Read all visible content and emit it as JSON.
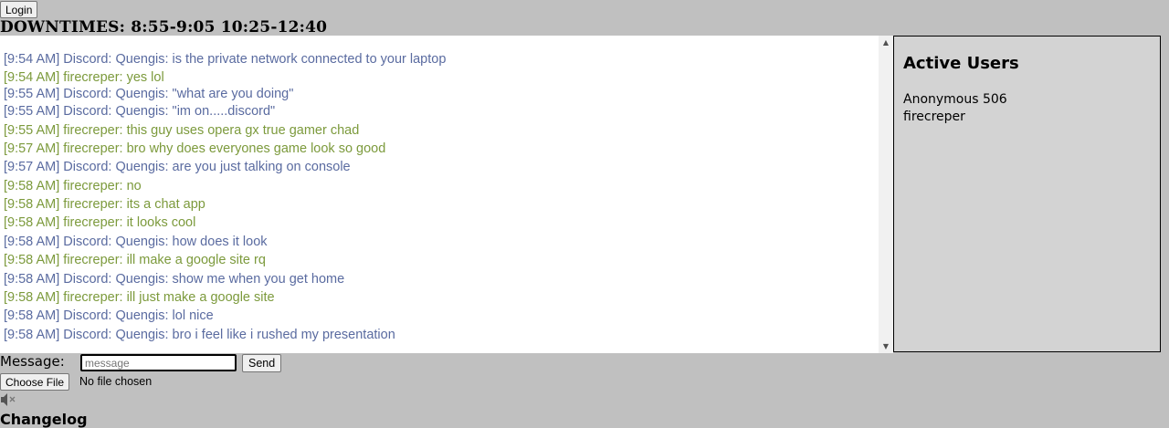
{
  "header": {
    "login_label": "Login",
    "downtimes": "DOWNTIMES: 8:55-9:05 10:25-12:40"
  },
  "colors": {
    "discord": "#5a6ba0",
    "user": "#7c9a3c"
  },
  "chat": {
    "messages": [
      {
        "text": "[9:54 AM] Discord: Quengis: is the private network connected to your laptop",
        "kind": "discord"
      },
      {
        "text": "[9:54 AM] firecreper: yes lol",
        "kind": "user"
      },
      {
        "text": "[9:55 AM] Discord: Quengis: \"what are you doing\"",
        "kind": "discord"
      },
      {
        "text": "[9:55 AM] Discord: Quengis: \"im on.....discord\"",
        "kind": "discord"
      },
      {
        "text": "[9:55 AM] firecreper: this guy uses opera gx true gamer chad",
        "kind": "user"
      },
      {
        "text": "[9:57 AM] firecreper: bro why does everyones game look so good",
        "kind": "user"
      },
      {
        "text": "[9:57 AM] Discord: Quengis: are you just talking on console",
        "kind": "discord"
      },
      {
        "text": "[9:58 AM] firecreper: no",
        "kind": "user"
      },
      {
        "text": "[9:58 AM] firecreper: its a chat app",
        "kind": "user"
      },
      {
        "text": "[9:58 AM] firecreper: it looks cool",
        "kind": "user"
      },
      {
        "text": "[9:58 AM] Discord: Quengis: how does it look",
        "kind": "discord"
      },
      {
        "text": "[9:58 AM] firecreper: ill make a google site rq",
        "kind": "user"
      },
      {
        "text": "[9:58 AM] Discord: Quengis: show me when you get home",
        "kind": "discord"
      },
      {
        "text": "[9:58 AM] firecreper: ill just make a google site",
        "kind": "user"
      },
      {
        "text": "[9:58 AM] Discord: Quengis: lol nice",
        "kind": "discord"
      },
      {
        "text": "[9:58 AM] Discord: Quengis: bro i feel like i rushed my presentation",
        "kind": "discord"
      }
    ]
  },
  "sidebar": {
    "title": "Active Users",
    "users": [
      "Anonymous 506",
      "firecreper"
    ]
  },
  "composer": {
    "label": "Message:",
    "placeholder": "message",
    "send_label": "Send",
    "file_button_label": "Choose File",
    "file_status": "No file chosen"
  },
  "footer": {
    "mute_icon": "speaker-muted-icon",
    "changelog_title": "Changelog"
  }
}
